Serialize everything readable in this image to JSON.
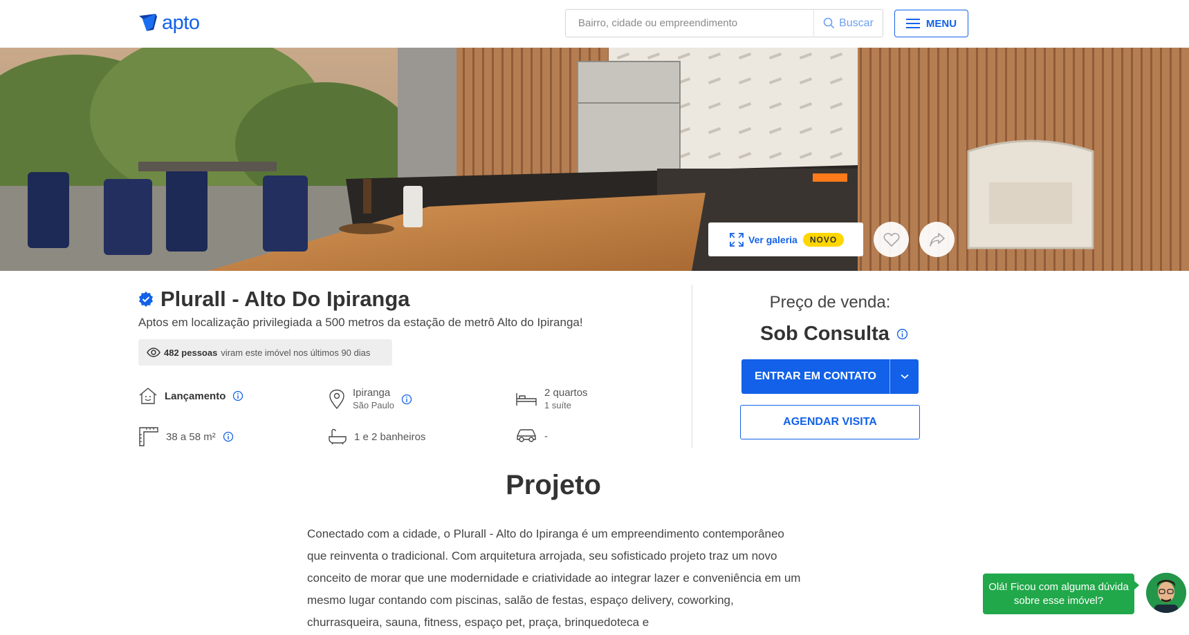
{
  "header": {
    "logo_text": "apto",
    "search_placeholder": "Bairro, cidade ou empreendimento",
    "search_button": "Buscar",
    "menu_button": "MENU"
  },
  "hero": {
    "gallery_label": "Ver galeria",
    "gallery_badge": "NOVO"
  },
  "property": {
    "title": "Plurall - Alto Do Ipiranga",
    "subtitle": "Aptos em localização privilegiada a 500 metros da estação de metrô Alto do Ipiranga!",
    "views_count": "482 pessoas",
    "views_text": "viram este imóvel nos últimos 90 dias",
    "features": {
      "status": "Lançamento",
      "neighborhood": "Ipiranga",
      "city": "São Paulo",
      "bedrooms": "2 quartos",
      "suites": "1 suíte",
      "area": "38 a 58 m²",
      "bathrooms": "1 e 2 banheiros",
      "parking": "-"
    }
  },
  "price": {
    "label": "Preço de venda:",
    "value": "Sob Consulta",
    "contact_button": "ENTRAR EM CONTATO",
    "visit_button": "AGENDAR VISITA"
  },
  "project": {
    "title": "Projeto",
    "description": "Conectado com a cidade, o Plurall - Alto do Ipiranga é um empreendimento contemporâneo que reinventa o tradicional. Com arquitetura arrojada, seu sofisticado projeto traz um novo conceito de morar que une modernidade e criatividade ao integrar lazer e conveniência em um mesmo lugar contando com piscinas, salão de festas, espaço delivery, coworking, churrasqueira, sauna, fitness, espaço pet, praça, brinquedoteca e"
  },
  "chat": {
    "message": "Olá! Ficou com alguma dúvida sobre esse imóvel?"
  },
  "colors": {
    "brand_blue": "#1261e8",
    "badge_yellow": "#ffd600",
    "chat_green": "#21a84a"
  }
}
